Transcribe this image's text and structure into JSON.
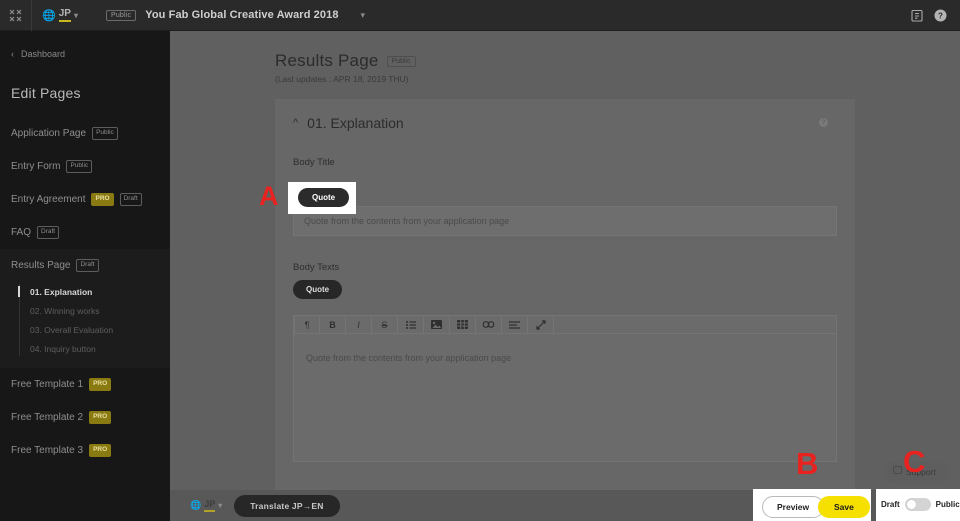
{
  "topbar": {
    "collapse_icon": "collapse-arrows-icon",
    "language": "JP",
    "globe_icon": "globe-icon",
    "visibility_badge": "Public",
    "project_title": "You Fab Global Creative Award 2018",
    "dropdown_caret": "chevron-down-icon",
    "notes_icon": "clipboard-icon",
    "help_icon": "help-circle-icon"
  },
  "sidebar": {
    "back_label": "Dashboard",
    "back_icon": "chevron-left-icon",
    "heading": "Edit Pages",
    "items": [
      {
        "label": "Application Page",
        "badges": [
          "Public"
        ]
      },
      {
        "label": "Entry Form",
        "badges": [
          "Public"
        ]
      },
      {
        "label": "Entry Agreement",
        "badges": [
          "PRO",
          "Draft"
        ]
      },
      {
        "label": "FAQ",
        "badges": [
          "Draft"
        ]
      },
      {
        "label": "Results Page",
        "badges": [
          "Draft"
        ]
      }
    ],
    "subitems": [
      {
        "label": "01. Explanation",
        "active": true
      },
      {
        "label": "02. Winning works",
        "active": false
      },
      {
        "label": "03. Overall Evaluation",
        "active": false
      },
      {
        "label": "04. Inquiry button",
        "active": false
      }
    ],
    "templates": [
      {
        "label": "Free Template 1",
        "badges": [
          "PRO"
        ]
      },
      {
        "label": "Free Template 2",
        "badges": [
          "PRO"
        ]
      },
      {
        "label": "Free Template 3",
        "badges": [
          "PRO"
        ]
      }
    ]
  },
  "page": {
    "title": "Results Page",
    "badge": "Public",
    "last_updated": "(Last updates : APR 18, 2019 THU)"
  },
  "card": {
    "collapse_icon": "chevron-up-icon",
    "title": "01. Explanation",
    "help_icon": "help-circle-icon",
    "help_glyph": "?",
    "body_title_label": "Body Title",
    "body_title_quote_button": "Quote",
    "body_title_placeholder": "Quote from the contents from your application page",
    "body_texts_label": "Body Texts",
    "body_texts_quote_button": "Quote",
    "body_texts_placeholder": "Quote from the contents from your application page",
    "toolbar": [
      {
        "name": "paragraph-icon",
        "glyph": "¶"
      },
      {
        "name": "bold-icon",
        "glyph": "B"
      },
      {
        "name": "italic-icon",
        "glyph": "I"
      },
      {
        "name": "strikethrough-icon",
        "glyph": "S"
      },
      {
        "name": "bullet-list-icon",
        "glyph": "☰"
      },
      {
        "name": "image-icon",
        "glyph": "Ὓc"
      },
      {
        "name": "table-icon",
        "glyph": "▦"
      },
      {
        "name": "link-icon",
        "glyph": "∞"
      },
      {
        "name": "align-icon",
        "glyph": "≡"
      },
      {
        "name": "expand-icon",
        "glyph": "↗"
      }
    ]
  },
  "bottombar": {
    "language": "JP",
    "globe_icon": "globe-icon",
    "translate_button": "Translate JP→EN"
  },
  "actions": {
    "preview_button": "Preview",
    "save_button": "Save",
    "draft_label": "Draft",
    "public_label": "Public",
    "toggle_state": "Draft",
    "support_button": "Support",
    "support_icon": "chat-icon"
  },
  "markers": {
    "a": "A",
    "b": "B",
    "c": "C"
  },
  "colors": {
    "accent_yellow": "#f5e000",
    "pro_badge": "#8a7a12",
    "marker_red": "#e8231f",
    "sidebar_bg": "#171717",
    "overlay": "#606060"
  }
}
